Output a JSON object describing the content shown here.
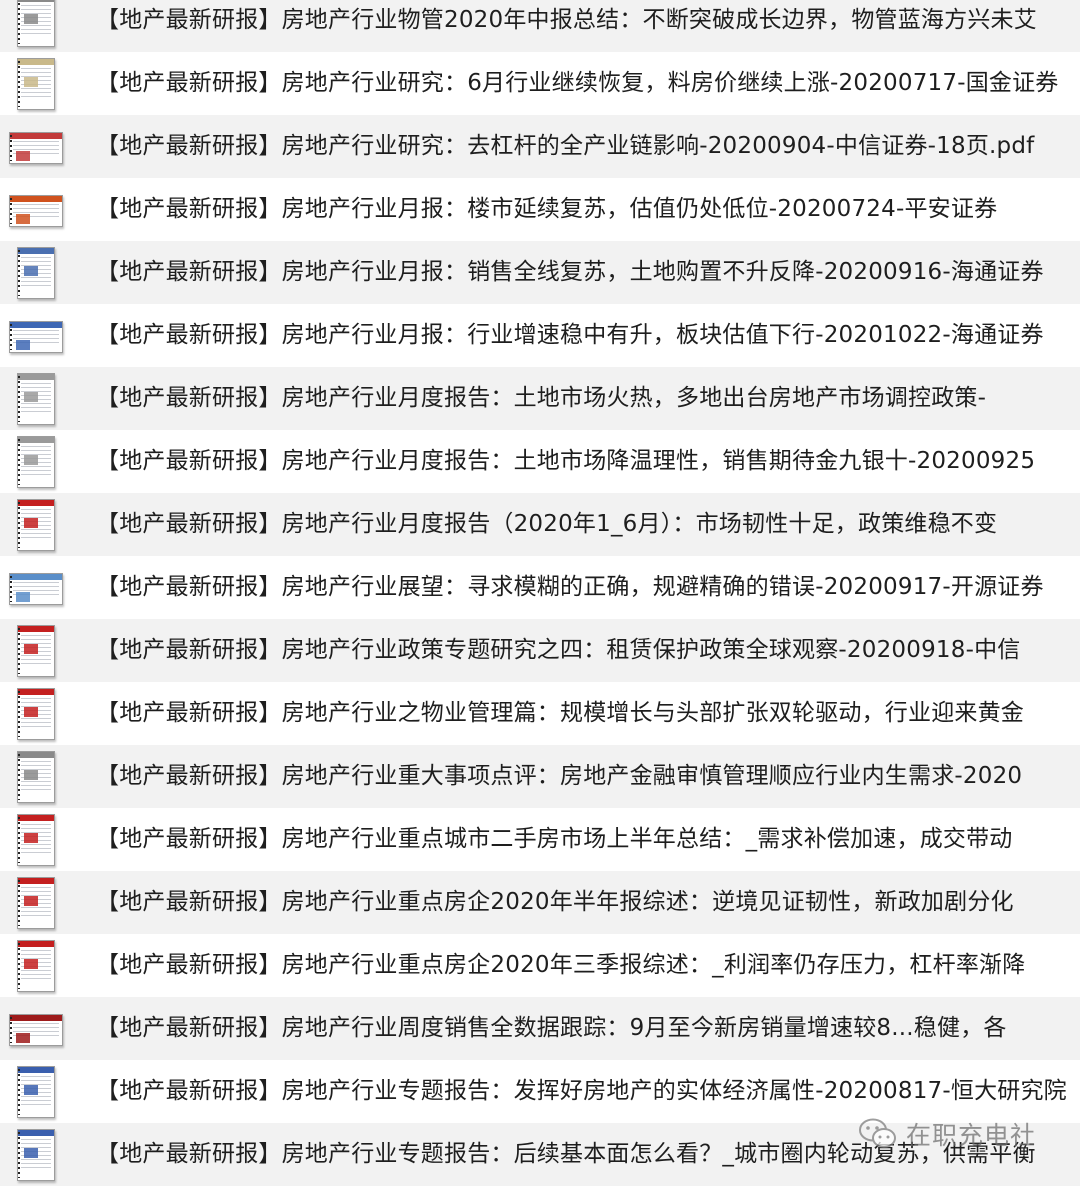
{
  "files": [
    {
      "name": "【地产最新研报】房地产行业物管2020年中报总结：不断突破成长边界，物管蓝海方兴未艾",
      "thumb": "portrait",
      "accent": "#8a8a8a"
    },
    {
      "name": "【地产最新研报】房地产行业研究：6月行业继续恢复，料房价继续上涨-20200717-国金证券",
      "thumb": "portrait",
      "accent": "#c9b98a"
    },
    {
      "name": "【地产最新研报】房地产行业研究：去杠杆的全产业链影响-20200904-中信证券-18页.pdf",
      "thumb": "landscape",
      "accent": "#c23b3b"
    },
    {
      "name": "【地产最新研报】房地产行业月报：楼市延续复苏，估值仍处低位-20200724-平安证券",
      "thumb": "landscape",
      "accent": "#d0521e"
    },
    {
      "name": "【地产最新研报】房地产行业月报：销售全线复苏，土地购置不升反降-20200916-海通证券",
      "thumb": "portrait",
      "accent": "#4a6fb0"
    },
    {
      "name": "【地产最新研报】房地产行业月报：行业增速稳中有升，板块估值下行-20201022-海通证券",
      "thumb": "landscape",
      "accent": "#3e67b4"
    },
    {
      "name": "【地产最新研报】房地产行业月度报告：土地市场火热，多地出台房地产市场调控政策-",
      "thumb": "portrait",
      "accent": "#9a9a9a"
    },
    {
      "name": "【地产最新研报】房地产行业月度报告：土地市场降温理性，销售期待金九银十-20200925",
      "thumb": "portrait",
      "accent": "#9a9a9a"
    },
    {
      "name": "【地产最新研报】房地产行业月度报告（2020年1_6月）：市场韧性十足，政策维稳不变",
      "thumb": "portrait",
      "accent": "#c42020"
    },
    {
      "name": "【地产最新研报】房地产行业展望：寻求模糊的正确，规避精确的错误-20200917-开源证券",
      "thumb": "landscape",
      "accent": "#5a8ec9"
    },
    {
      "name": "【地产最新研报】房地产行业政策专题研究之四：租赁保护政策全球观察-20200918-中信",
      "thumb": "portrait",
      "accent": "#c42020"
    },
    {
      "name": "【地产最新研报】房地产行业之物业管理篇：规模增长与头部扩张双轮驱动，行业迎来黄金",
      "thumb": "portrait",
      "accent": "#c42020"
    },
    {
      "name": "【地产最新研报】房地产行业重大事项点评：房地产金融审慎管理顺应行业内生需求-2020",
      "thumb": "portrait",
      "accent": "#8a8a8a"
    },
    {
      "name": "【地产最新研报】房地产行业重点城市二手房市场上半年总结：_需求补偿加速，成交带动",
      "thumb": "portrait",
      "accent": "#c42020"
    },
    {
      "name": "【地产最新研报】房地产行业重点房企2020年半年报综述：逆境见证韧性，新政加剧分化",
      "thumb": "portrait",
      "accent": "#c42020"
    },
    {
      "name": "【地产最新研报】房地产行业重点房企2020年三季报综述：_利润率仍存压力，杠杆率渐降",
      "thumb": "portrait",
      "accent": "#c42020"
    },
    {
      "name": "【地产最新研报】房地产行业周度销售全数据跟踪：9月至今新房销量增速较8...稳健，各",
      "thumb": "landscape",
      "accent": "#9e1b1b"
    },
    {
      "name": "【地产最新研报】房地产行业专题报告：发挥好房地产的实体经济属性-20200817-恒大研究院",
      "thumb": "portrait",
      "accent": "#3a5fae"
    },
    {
      "name": "【地产最新研报】房地产行业专题报告：后续基本面怎么看？_城市圈内轮动复苏，供需平衡",
      "thumb": "portrait",
      "accent": "#3a5fae"
    }
  ],
  "watermark": {
    "text": "在职充电社",
    "icon": "wechat-official-account-icon"
  }
}
